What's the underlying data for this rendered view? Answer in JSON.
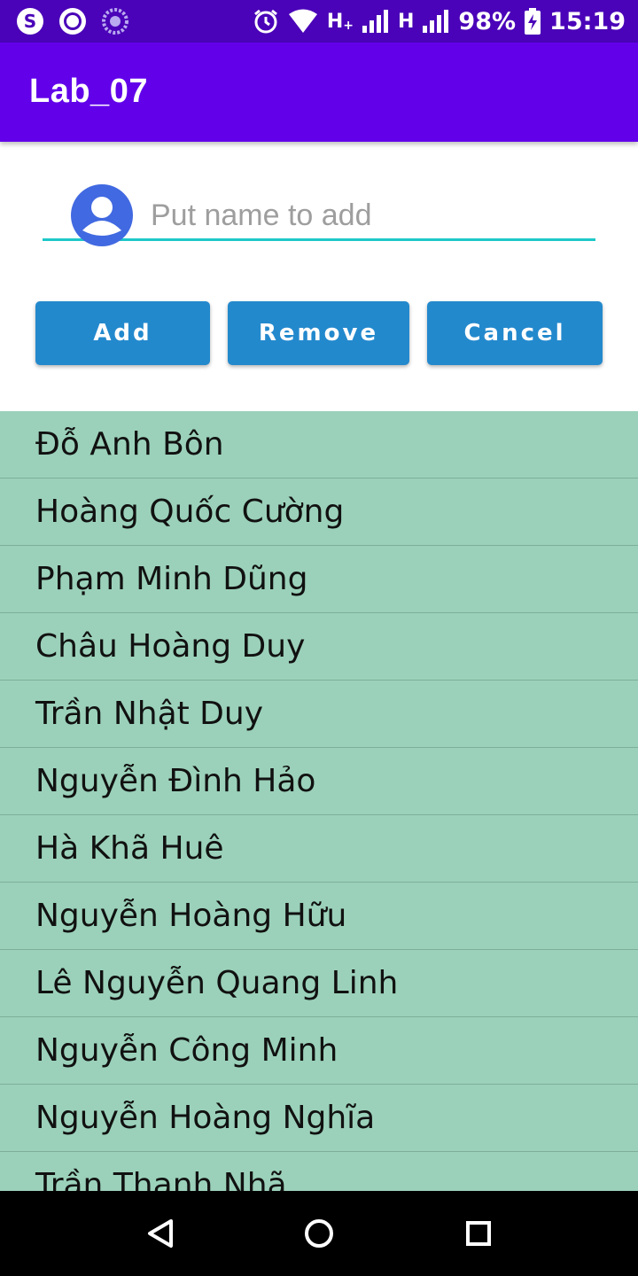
{
  "status_bar": {
    "time": "15:19",
    "battery": "98%",
    "network_1": "H",
    "network_1_sup": "+",
    "network_2": "H",
    "icons": [
      "skype-icon",
      "record-icon",
      "loading-icon",
      "alarm-icon",
      "wifi-icon",
      "signal-icon",
      "signal-icon",
      "battery-charging-icon"
    ]
  },
  "app_bar": {
    "title": "Lab_07"
  },
  "name_field": {
    "value": "",
    "placeholder": "Put name to add",
    "accent_color": "#1ec8c8"
  },
  "buttons": {
    "add_label": "Add",
    "remove_label": "Remove",
    "cancel_label": "Cancel",
    "color": "#2389cd"
  },
  "names_list": {
    "background": "#9bd1ba",
    "items": [
      "Đỗ Anh Bôn",
      "Hoàng Quốc Cường",
      "Phạm Minh Dũng",
      "Châu Hoàng Duy",
      "Trần Nhật Duy",
      "Nguyễn Đình Hảo",
      "Hà Khã Huê",
      "Nguyễn Hoàng Hữu",
      "Lê Nguyễn Quang Linh",
      "Nguyễn Công Minh",
      "Nguyễn Hoàng Nghĩa",
      "Trần Thanh Nhã"
    ]
  },
  "colors": {
    "status_bar": "#4a03b8",
    "app_bar": "#6200ea",
    "avatar": "#4169e1"
  },
  "nav_bar": {
    "icons": [
      "back-icon",
      "home-icon",
      "recent-apps-icon"
    ]
  }
}
